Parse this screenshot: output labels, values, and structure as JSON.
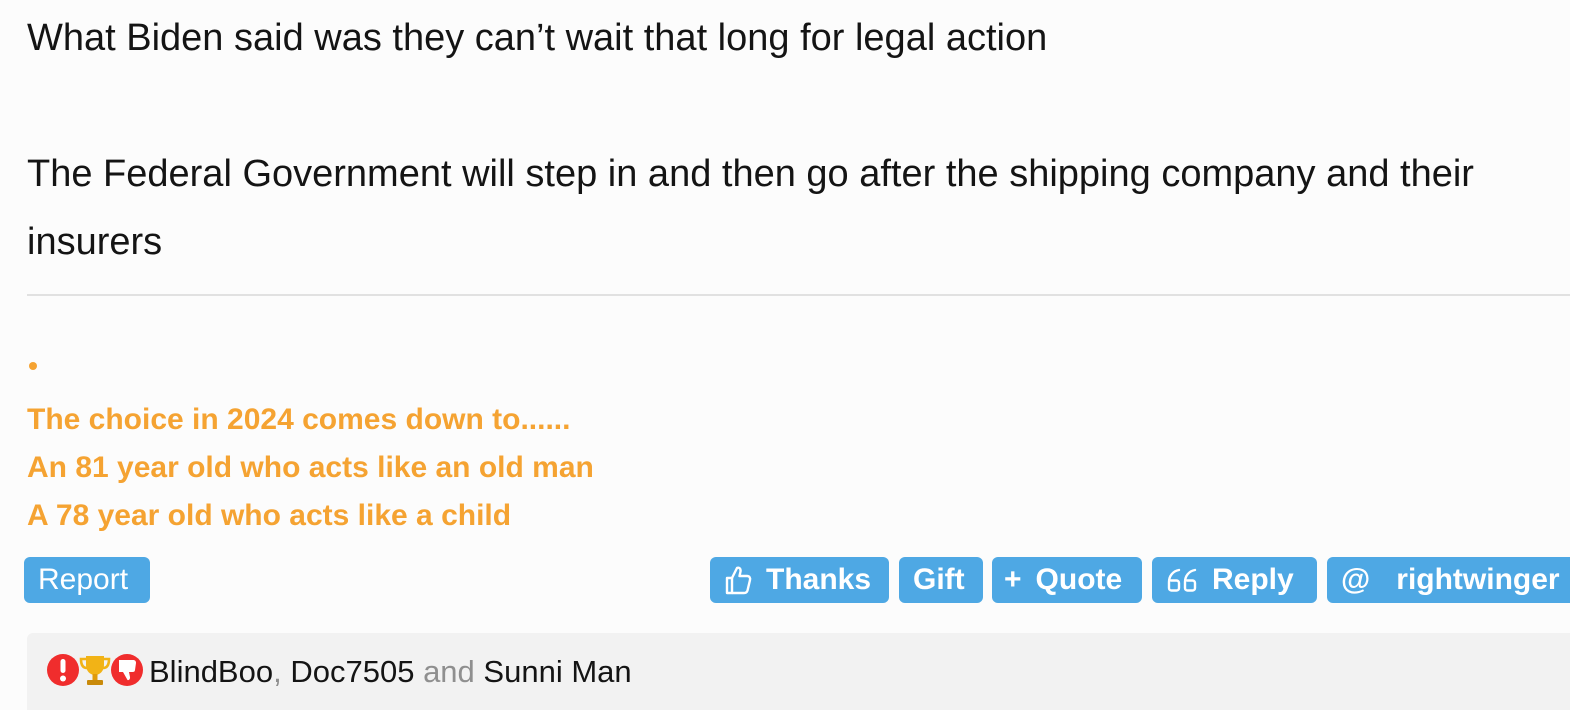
{
  "post": {
    "lines": [
      "What Biden said was they can’t wait that long for legal action",
      "The Federal Government will step in and then go after the shipping company and their insurers"
    ]
  },
  "signature": {
    "lines": [
      "The choice in 2024 comes down to......",
      "An 81 year old who acts like an old man",
      "A 78 year old who acts like a child"
    ]
  },
  "actions": {
    "report": "Report",
    "thanks": "Thanks",
    "gift": "Gift",
    "quote": "Quote",
    "reply": "Reply",
    "mention": "rightwinger",
    "plus_glyph": "+",
    "at_glyph": "@"
  },
  "reactions": {
    "icons": [
      "exclamation-icon",
      "trophy-icon",
      "thumbs-down-icon"
    ],
    "users": [
      "BlindBoo",
      "Doc7505",
      "Sunni Man"
    ],
    "separator_comma": ",",
    "separator_and": "and"
  },
  "colors": {
    "accent": "#4ea8e4",
    "signature": "#f5a332",
    "reaction_bar": "#f2f2f2"
  }
}
